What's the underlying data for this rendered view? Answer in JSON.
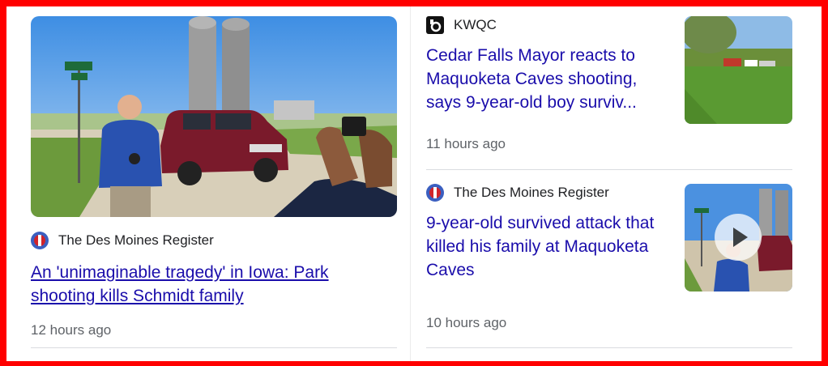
{
  "stories": {
    "main": {
      "source": "The Des Moines Register",
      "headline": "An 'unimaginable tragedy' in Iowa: Park shooting kills Schmidt family",
      "time": "12 hours ago",
      "image_icon": "news-photo"
    },
    "kwqc": {
      "source": "KWQC",
      "headline": "Cedar Falls Mayor reacts to Maquoketa Caves shooting, says 9-year-old boy surviv...",
      "time": "11 hours ago",
      "thumb_icon": "park-scene-thumbnail"
    },
    "register2": {
      "source": "The Des Moines Register",
      "headline": "9-year-old survived attack that killed his family at Maquoketa Caves",
      "time": "10 hours ago",
      "thumb_icon": "video-thumbnail"
    }
  },
  "colors": {
    "link": "#1a0dab",
    "source_text": "#202124",
    "meta_text": "#5f6368",
    "frame_border": "#ff0000"
  }
}
